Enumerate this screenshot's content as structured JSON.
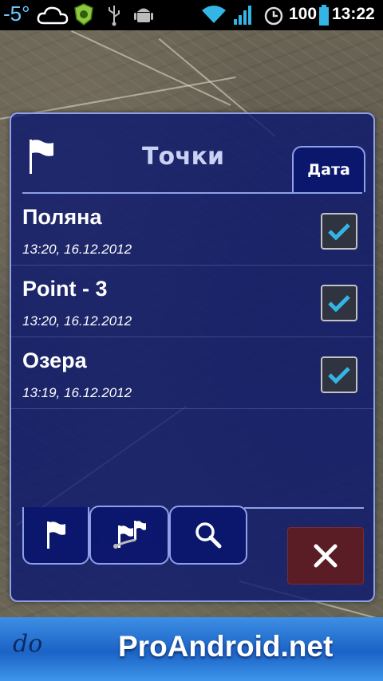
{
  "status_bar": {
    "temperature": "-5°",
    "battery_percent": "100",
    "time": "13:22",
    "icons": [
      "cloud-icon",
      "shield-app-icon",
      "usb-icon",
      "android-icon",
      "wifi-icon",
      "signal-icon",
      "alarm-icon",
      "battery-icon"
    ],
    "accent": "#33b5e5"
  },
  "dialog": {
    "title": "Точки",
    "sort_tab_label": "Дата",
    "points": [
      {
        "name": "Поляна",
        "date": "13:20, 16.12.2012",
        "checked": true
      },
      {
        "name": "Point - 3",
        "date": "13:20, 16.12.2012",
        "checked": true
      },
      {
        "name": "Озера",
        "date": "13:19, 16.12.2012",
        "checked": true
      }
    ],
    "tabs": [
      "flag-tab",
      "route-tab",
      "search-tab"
    ],
    "close_button_color": "#5a1c25",
    "check_color": "#33b5e5"
  },
  "banner": {
    "text": "ProAndroid.net"
  }
}
